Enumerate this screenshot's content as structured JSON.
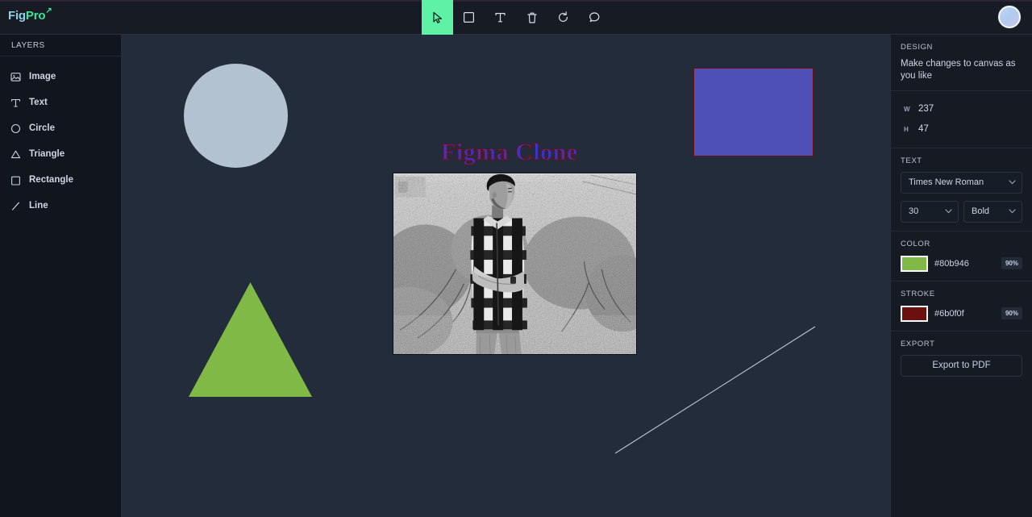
{
  "app": {
    "logo_primary": "Fig",
    "logo_secondary": "Pro",
    "logo_arrow": "↗"
  },
  "toolbar": {
    "tools": [
      {
        "name": "select-cursor-tool",
        "label": "Select",
        "active": true
      },
      {
        "name": "rectangle-tool",
        "label": "Rectangle",
        "active": false
      },
      {
        "name": "text-tool",
        "label": "Text",
        "active": false
      },
      {
        "name": "delete-tool",
        "label": "Delete",
        "active": false
      },
      {
        "name": "reset-tool",
        "label": "Reset",
        "active": false
      },
      {
        "name": "comment-tool",
        "label": "Comment",
        "active": false
      }
    ],
    "active_color": "#5df2a5"
  },
  "sidebar": {
    "heading": "LAYERS",
    "items": [
      {
        "label": "Image",
        "icon": "image-icon"
      },
      {
        "label": "Text",
        "icon": "text-icon"
      },
      {
        "label": "Circle",
        "icon": "circle-icon"
      },
      {
        "label": "Triangle",
        "icon": "triangle-icon"
      },
      {
        "label": "Rectangle",
        "icon": "rectangle-icon"
      },
      {
        "label": "Line",
        "icon": "line-icon"
      }
    ]
  },
  "canvas": {
    "background": "#232c3b",
    "objects": {
      "circle": {
        "fill": "#b2c2d1"
      },
      "rectangle": {
        "fill": "#4f4fb8",
        "stroke": "#6b0f0f"
      },
      "triangle": {
        "fill": "#80b946"
      },
      "text": {
        "content": "Figma Clone",
        "fill": "#3b33c9",
        "stroke": "#6b0f0f",
        "font": "Times New Roman",
        "size": "30",
        "weight": "Bold"
      },
      "line": {
        "stroke": "#b9c6d6"
      },
      "image": {
        "description": "black and white photo of a person in a plaid shirt standing in front of foliage"
      }
    }
  },
  "design_panel": {
    "heading": "DESIGN",
    "subtitle": "Make changes to canvas as you like",
    "dimensions": {
      "width_label": "W",
      "width_value": "237",
      "height_label": "H",
      "height_value": "47"
    },
    "text_section": {
      "heading": "TEXT",
      "font_family": "Times New Roman",
      "font_size": "30",
      "font_weight": "Bold"
    },
    "color_section": {
      "heading": "COLOR",
      "hex": "#80b946",
      "opacity": "90%"
    },
    "stroke_section": {
      "heading": "STROKE",
      "hex": "#6b0f0f",
      "opacity": "90%"
    },
    "export_section": {
      "heading": "EXPORT",
      "button_label": "Export to PDF"
    }
  }
}
